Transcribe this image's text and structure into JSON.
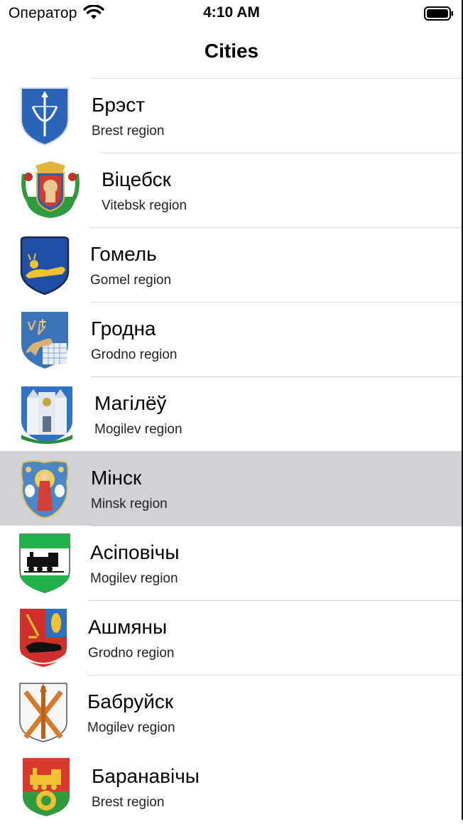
{
  "status_bar": {
    "carrier": "Оператор",
    "time": "4:10 AM",
    "wifi_icon": "wifi-icon",
    "battery_icon": "battery-icon"
  },
  "nav": {
    "title": "Cities"
  },
  "cities": [
    {
      "name": "Брэст",
      "region": "Brest region",
      "icon": "brest-coat-of-arms-icon",
      "selected": false
    },
    {
      "name": "Віцебск",
      "region": "Vitebsk region",
      "icon": "vitebsk-coat-of-arms-icon",
      "selected": false
    },
    {
      "name": "Гомель",
      "region": "Gomel region",
      "icon": "gomel-coat-of-arms-icon",
      "selected": false
    },
    {
      "name": "Гродна",
      "region": "Grodno region",
      "icon": "grodno-coat-of-arms-icon",
      "selected": false
    },
    {
      "name": "Магілёў",
      "region": "Mogilev region",
      "icon": "mogilev-coat-of-arms-icon",
      "selected": false
    },
    {
      "name": "Мінск",
      "region": "Minsk region",
      "icon": "minsk-coat-of-arms-icon",
      "selected": true
    },
    {
      "name": "Асіповічы",
      "region": "Mogilev region",
      "icon": "asipovichy-coat-of-arms-icon",
      "selected": false
    },
    {
      "name": "Ашмяны",
      "region": "Grodno region",
      "icon": "ashmyany-coat-of-arms-icon",
      "selected": false
    },
    {
      "name": "Бабруйск",
      "region": "Mogilev region",
      "icon": "babruysk-coat-of-arms-icon",
      "selected": false
    },
    {
      "name": "Баранавічы",
      "region": "Brest region",
      "icon": "baranavichy-coat-of-arms-icon",
      "selected": false
    }
  ]
}
